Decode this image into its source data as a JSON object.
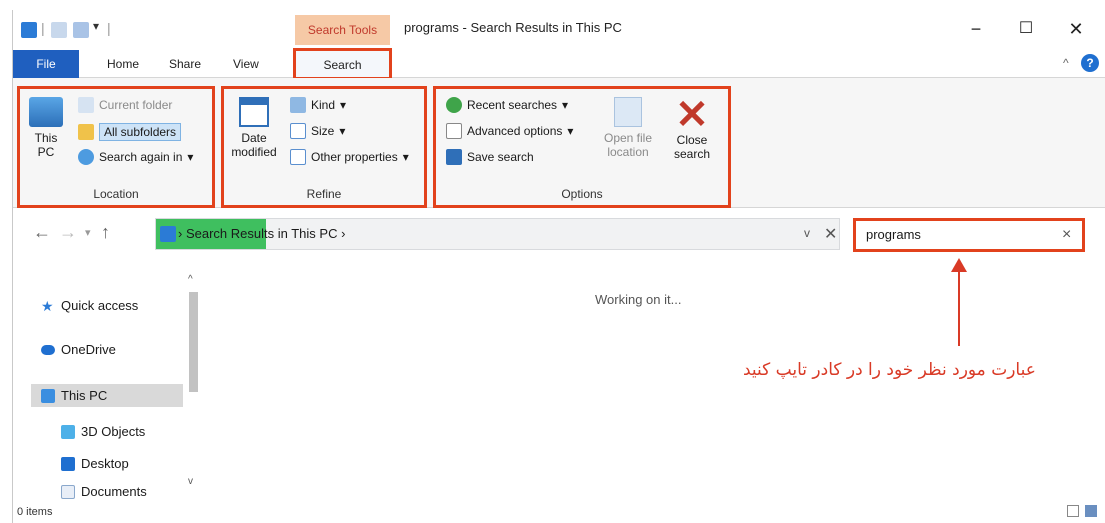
{
  "window": {
    "title": "programs - Search Results in This PC",
    "context_tab_group": "Search Tools",
    "controls": {
      "minimize": "−",
      "maximize": "☐",
      "close": "✕"
    }
  },
  "tabs": [
    {
      "label": "File"
    },
    {
      "label": "Home"
    },
    {
      "label": "Share"
    },
    {
      "label": "View"
    },
    {
      "label": "Search"
    }
  ],
  "ribbon": {
    "location": {
      "label": "Location",
      "this_pc": "This PC",
      "current_folder": "Current folder",
      "all_subfolders": "All subfolders",
      "search_again_in": "Search again in"
    },
    "refine": {
      "label": "Refine",
      "date_modified": "Date modified",
      "kind": "Kind",
      "size": "Size",
      "other_properties": "Other properties"
    },
    "options": {
      "label": "Options",
      "recent_searches": "Recent searches",
      "advanced_options": "Advanced options",
      "save_search": "Save search",
      "open_file_location": "Open file location",
      "close_search": "Close search"
    }
  },
  "address": {
    "path": "Search Results in This PC",
    "separator": "›"
  },
  "search": {
    "value": "programs",
    "clear": "×"
  },
  "nav_pane": {
    "items": [
      {
        "label": "Quick access",
        "icon": "star-icon"
      },
      {
        "label": "OneDrive",
        "icon": "cloud-icon"
      },
      {
        "label": "This PC",
        "icon": "computer-icon"
      },
      {
        "label": "3D Objects",
        "icon": "cube-icon"
      },
      {
        "label": "Desktop",
        "icon": "desktop-icon"
      },
      {
        "label": "Documents",
        "icon": "document-icon"
      }
    ]
  },
  "content": {
    "status": "Working on it..."
  },
  "annotation": {
    "text": "عبارت مورد نظر خود را در کادر تایپ کنید"
  },
  "status_bar": {
    "items_count": "0 items"
  },
  "colors": {
    "highlight": "#e2421c",
    "file_tab": "#1f5fbf",
    "context_tab": "#f6c9a6",
    "annotation": "#d93a26"
  }
}
